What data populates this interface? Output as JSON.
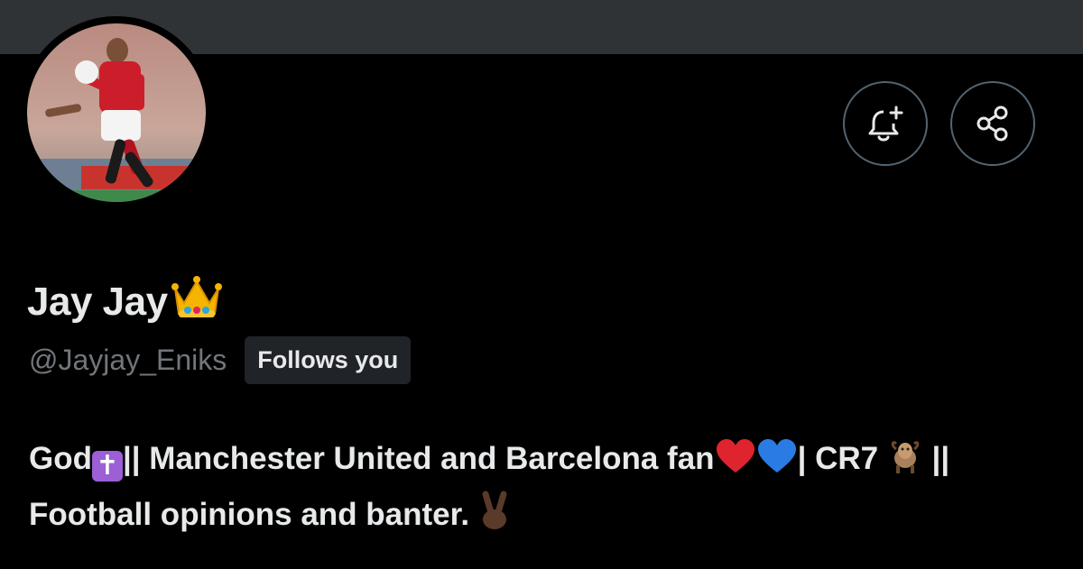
{
  "profile": {
    "display_name": "Jay Jay",
    "handle": "@Jayjay_Eniks",
    "follows_you_badge": "Follows you",
    "bio": {
      "part1": "God",
      "part2": "|| Manchester United and Barcelona fan",
      "part3": "| CR7 ",
      "part4": " ||",
      "line2": "Football opinions and banter. "
    }
  },
  "icons": {
    "notify": "bell-plus-icon",
    "share": "share-icon",
    "crown": "crown-emoji",
    "cross": "latin-cross-emoji",
    "heart_red": "red-heart-emoji",
    "heart_blue": "blue-heart-emoji",
    "goat": "goat-emoji",
    "peace": "victory-hand-emoji"
  },
  "colors": {
    "background": "#000000",
    "banner": "#2f3336",
    "text_primary": "#e7e9ea",
    "text_secondary": "#71767b",
    "badge_bg": "#202327",
    "button_border": "#536471"
  }
}
